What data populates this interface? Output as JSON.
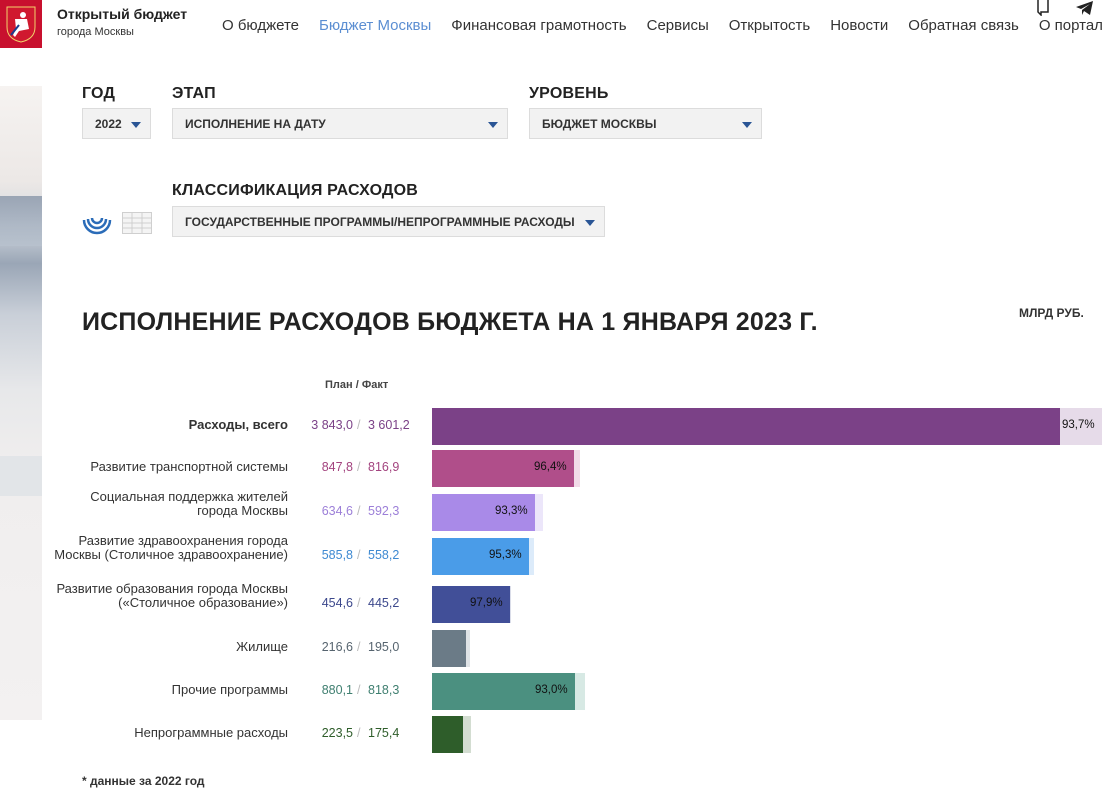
{
  "header": {
    "brand_title": "Открытый бюджет",
    "brand_subtitle": "города Москвы",
    "nav": [
      {
        "label": "О бюджете",
        "active": false
      },
      {
        "label": "Бюджет Москвы",
        "active": true
      },
      {
        "label": "Финансовая грамотность",
        "active": false
      },
      {
        "label": "Сервисы",
        "active": false
      },
      {
        "label": "Открытость",
        "active": false
      },
      {
        "label": "Новости",
        "active": false
      },
      {
        "label": "Обратная связь",
        "active": false
      },
      {
        "label": "О портале",
        "active": false
      }
    ],
    "icons": [
      "bookmark-icon",
      "telegram-icon"
    ]
  },
  "filters": {
    "year": {
      "label": "ГОД",
      "value": "2022"
    },
    "stage": {
      "label": "ЭТАП",
      "value": "ИСПОЛНЕНИЕ НА ДАТУ"
    },
    "level": {
      "label": "УРОВЕНЬ",
      "value": "БЮДЖЕТ МОСКВЫ"
    },
    "classification": {
      "label": "КЛАССИФИКАЦИЯ РАСХОДОВ",
      "value": "ГОСУДАРСТВЕННЫЕ ПРОГРАММЫ/НЕПРОГРАММНЫЕ РАСХОДЫ"
    }
  },
  "view_toggle": {
    "icons": [
      "radial-chart-icon",
      "table-icon"
    ]
  },
  "report": {
    "title": "ИСПОЛНЕНИЕ РАСХОДОВ БЮДЖЕТА НА  1 ЯНВАРЯ 2023 Г.",
    "units": "МЛРД РУБ.",
    "column_header": "План / Факт",
    "separator": "/",
    "footnote": "* данные за 2022 год"
  },
  "chart_data": {
    "type": "bar",
    "orientation": "horizontal",
    "xlim": [
      0,
      3843.0
    ],
    "categories": [
      "Расходы, всего",
      "Развитие транспортной системы",
      "Социальная поддержка жителей города Москвы",
      "Развитие здравоохранения города Москвы (Столичное здравоохранение)",
      "Развитие образования города Москвы («Столичное образование»)",
      "Жилище",
      "Прочие программы",
      "Непрограммные расходы"
    ],
    "series": [
      {
        "name": "План",
        "values": [
          3843.0,
          847.8,
          634.6,
          585.8,
          454.6,
          216.6,
          880.1,
          223.5
        ]
      },
      {
        "name": "Факт",
        "values": [
          3601.2,
          816.9,
          592.3,
          558.2,
          445.2,
          195.0,
          818.3,
          175.4
        ]
      }
    ],
    "rows": [
      {
        "label": "Расходы, всего",
        "plan": "3 843,0",
        "fact": "3 601,2",
        "pct": "93,7%",
        "color": "#7b4187",
        "light": "#e6dbe9",
        "num_color": "#7b4187",
        "bold": true
      },
      {
        "label": "Развитие транспортной системы",
        "plan": "847,8",
        "fact": "816,9",
        "pct": "96,4%",
        "color": "#b04e8a",
        "light": "#f1dbe8",
        "num_color": "#a3447f",
        "bold": false
      },
      {
        "label": "Социальная поддержка жителей города Москвы",
        "plan": "634,6",
        "fact": "592,3",
        "pct": "93,3%",
        "color": "#a98ae8",
        "light": "#ece6fa",
        "num_color": "#9c7fd8",
        "bold": false
      },
      {
        "label": "Развитие здравоохранения города Москвы (Столичное здравоохранение)",
        "plan": "585,8",
        "fact": "558,2",
        "pct": "95,3%",
        "color": "#4a9ce8",
        "light": "#dcebfa",
        "num_color": "#3f8ad2",
        "bold": false
      },
      {
        "label": "Развитие образования города Москвы («Столичное образование»)",
        "plan": "454,6",
        "fact": "445,2",
        "pct": "97,9%",
        "color": "#414f98",
        "light": "#dadde9",
        "num_color": "#3c488c",
        "bold": false
      },
      {
        "label": "Жилище",
        "plan": "216,6",
        "fact": "195,0",
        "pct": "",
        "color": "#6b7b87",
        "light": "#dfe3e6",
        "num_color": "#56646f",
        "bold": false
      },
      {
        "label": "Прочие программы",
        "plan": "880,1",
        "fact": "818,3",
        "pct": "93,0%",
        "color": "#4b9080",
        "light": "#d7e9e4",
        "num_color": "#3f7f70",
        "bold": false
      },
      {
        "label": "Непрограммные расходы",
        "plan": "223,5",
        "fact": "175,4",
        "pct": "",
        "color": "#2e5d2a",
        "light": "#d3ddd1",
        "num_color": "#2e5d2a",
        "bold": false
      }
    ]
  }
}
